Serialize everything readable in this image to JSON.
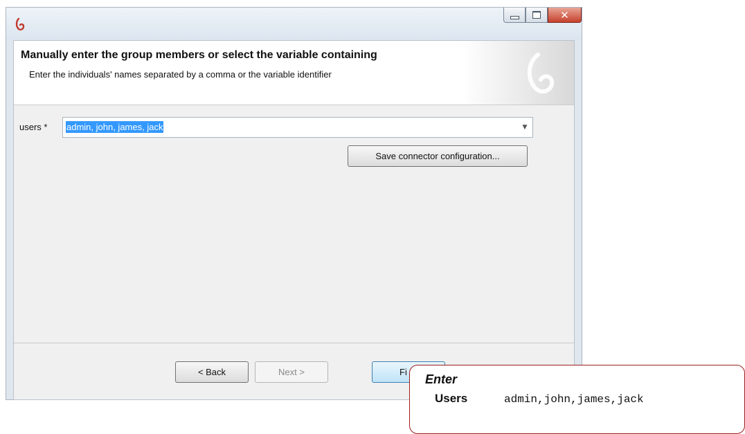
{
  "window": {
    "controls": [
      "minimize",
      "maximize",
      "close"
    ]
  },
  "header": {
    "title": "Manually enter the group members or select the variable containing",
    "subtitle": "Enter the individuals' names separated by a comma or the variable identifier"
  },
  "form": {
    "users_label": "users *",
    "users_value": "admin, john, james, jack"
  },
  "buttons": {
    "save_config": "Save connector configuration...",
    "back": "< Back",
    "next": "Next >",
    "finish": "Fi"
  },
  "callout": {
    "title": "Enter",
    "key": "Users",
    "value": "admin,john,james,jack"
  },
  "colors": {
    "selection": "#3399ff",
    "close_button": "#c6412c",
    "callout_border": "#9e1c1c",
    "brand": "#c0392b"
  },
  "icons": {
    "app": "bonita-logo-icon",
    "close": "close-icon",
    "dropdown": "chevron-down-icon"
  }
}
